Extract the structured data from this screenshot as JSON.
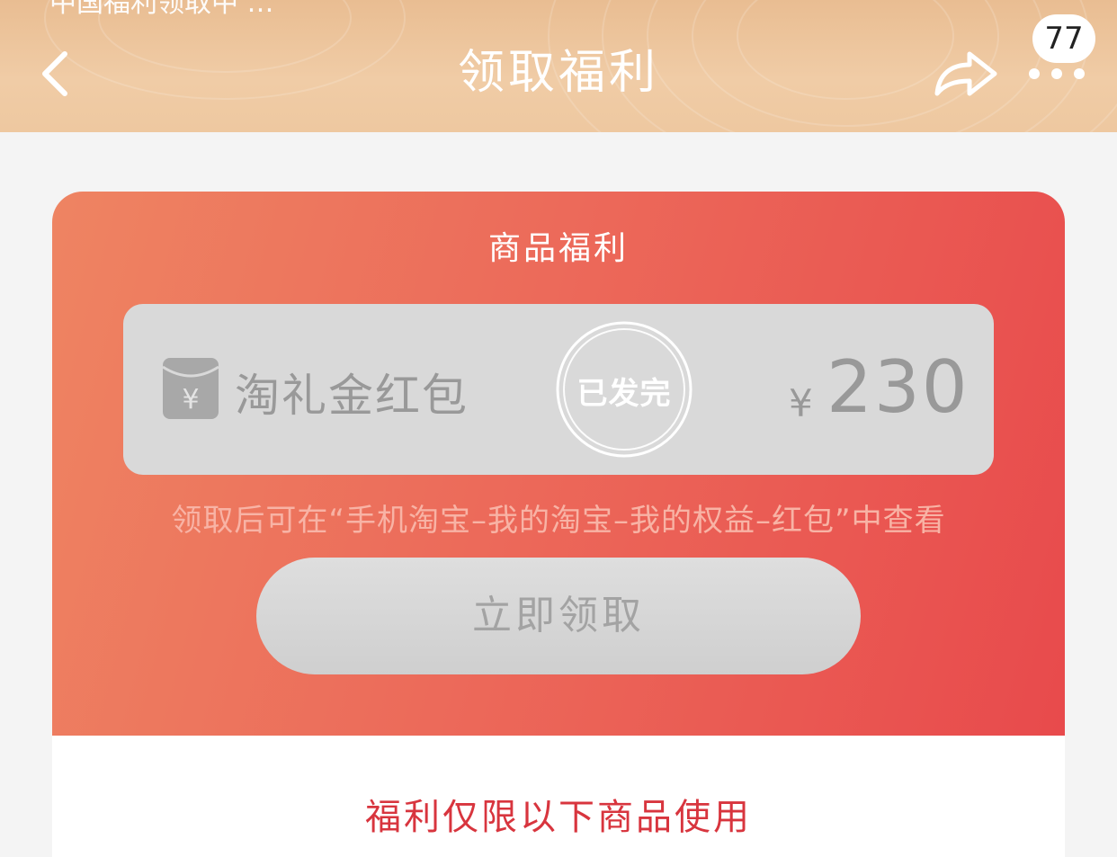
{
  "status_bar": {
    "partial_text": "中国福利领取中 …"
  },
  "nav": {
    "title": "领取福利",
    "back_icon": "chevron-left-icon",
    "share_icon": "share-arrow-icon",
    "more_icon": "more-dots-icon",
    "badge_count": "77"
  },
  "card": {
    "title": "商品福利",
    "coupon": {
      "icon": "red-envelope-yen-icon",
      "name": "淘礼金红包",
      "stamp": "已发完",
      "currency": "¥",
      "amount": "230"
    },
    "hint": "领取后可在“手机淘宝–我的淘宝–我的权益–红包”中查看",
    "claim_button": "立即领取"
  },
  "products": {
    "title": "福利仅限以下商品使用"
  },
  "colors": {
    "header_bg": "#e9bd92",
    "card_gradient_start": "#ee8462",
    "card_gradient_end": "#e84a4c",
    "disabled_gray": "#d9d9d9",
    "accent_red": "#d8353e"
  }
}
